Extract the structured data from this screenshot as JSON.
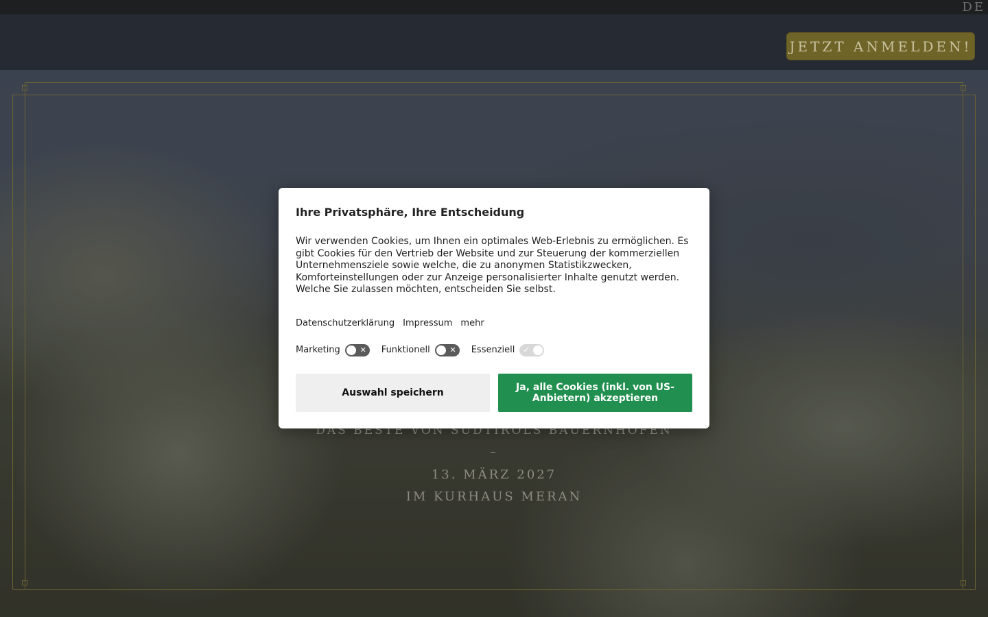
{
  "topbar": {
    "language": "DE"
  },
  "header": {
    "cta_label": "JETZT ANMELDEN!"
  },
  "hero": {
    "title": "",
    "subtitle": "DAS BESTE VON SÜDTIROLS BAUERNHÖFEN",
    "dash": "–",
    "date": "13. MÄRZ 2027",
    "location": "IM  KURHAUS MERAN"
  },
  "consent": {
    "title": "Ihre Privatsphäre, Ihre Entscheidung",
    "body": "Wir verwenden Cookies, um Ihnen ein optimales Web-Erlebnis zu ermöglichen. Es gibt Cookies für den Vertrieb der Website und zur Steuerung der kommerziellen Unternehmensziele sowie welche, die zu anonymen Statistikzwecken, Komforteinstellungen oder zur Anzeige personalisierter Inhalte genutzt werden. Welche Sie zulassen möchten, entscheiden Sie selbst.",
    "links": [
      "Datenschutzerklärung",
      "Impressum",
      "mehr"
    ],
    "toggles": [
      {
        "label": "Marketing",
        "enabled": false,
        "disabled": false,
        "mark": "✕"
      },
      {
        "label": "Funktionell",
        "enabled": false,
        "disabled": false,
        "mark": "✕"
      },
      {
        "label": "Essenziell",
        "enabled": true,
        "disabled": true,
        "mark": "✓"
      }
    ],
    "save_label": "Auswahl speichern",
    "accept_label": "Ja, alle Cookies (inkl. von US-Anbietern) akzeptieren",
    "accept_color": "#208f4f"
  }
}
